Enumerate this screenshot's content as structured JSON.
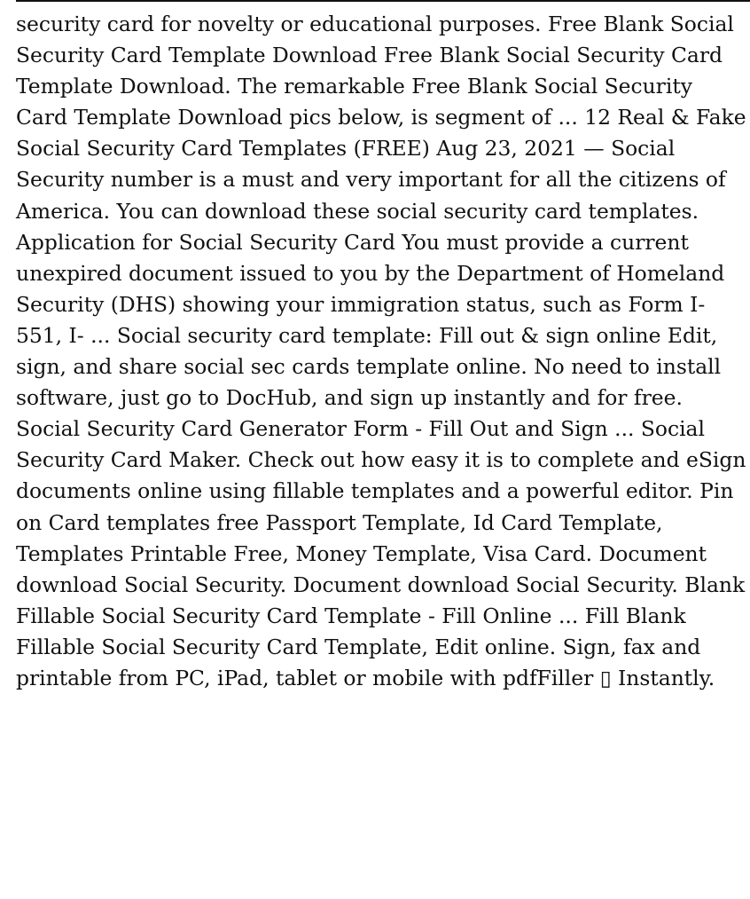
{
  "article": {
    "body": "security card for novelty or educational purposes. Free Blank Social Security Card Template Download Free Blank Social Security Card Template Download. The remarkable Free Blank Social Security Card Template Download pics below, is segment of ... 12 Real & Fake Social Security Card Templates (FREE) Aug 23, 2021 — Social Security number is a must and very important for all the citizens of America. You can download these social security card templates. Application for Social Security Card You must provide a current unexpired document issued to you by the Department of Homeland Security (DHS) showing your immigration status, such as Form I-551, I- ... Social security card template: Fill out & sign online Edit, sign, and share social sec cards template online. No need to install software, just go to DocHub, and sign up instantly and for free. Social Security Card Generator Form - Fill Out and Sign ... Social Security Card Maker. Check out how easy it is to complete and eSign documents online using fillable templates and a powerful editor. Pin on Card templates free Passport Template, Id Card Template, Templates Printable Free, Money Template, Visa Card. Document download Social Security. Document download Social Security. Blank Fillable Social Security Card Template - Fill Online ... Fill Blank Fillable Social Security Card Template, Edit online. Sign, fax and printable from PC, iPad, tablet or mobile with pdfFiller ▯ Instantly."
  }
}
